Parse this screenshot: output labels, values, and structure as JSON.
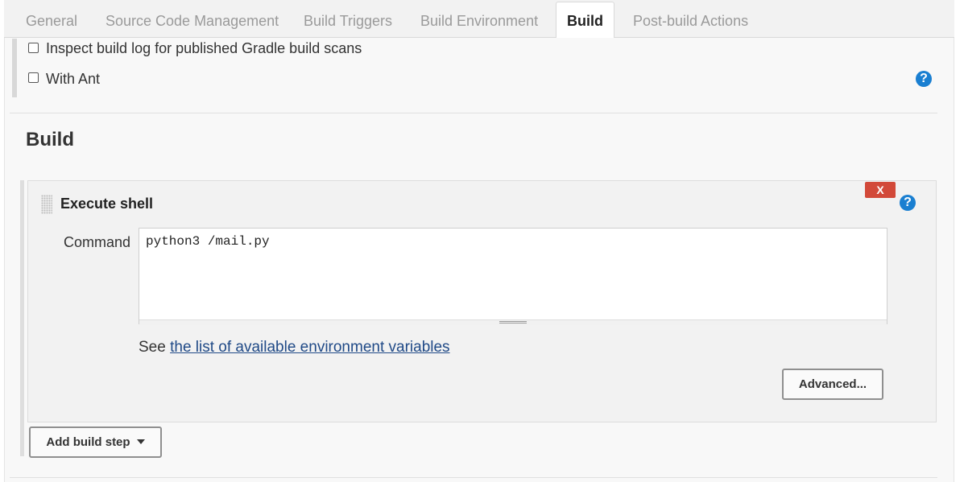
{
  "tabs": [
    {
      "label": "General"
    },
    {
      "label": "Source Code Management"
    },
    {
      "label": "Build Triggers"
    },
    {
      "label": "Build Environment"
    },
    {
      "label": "Build",
      "active": true
    },
    {
      "label": "Post-build Actions"
    }
  ],
  "build_env": {
    "inspect_gradle_label": "Inspect build log for published Gradle build scans",
    "inspect_gradle_checked": false,
    "with_ant_label": "With Ant",
    "with_ant_checked": false,
    "help_glyph": "?"
  },
  "build_section": {
    "title": "Build",
    "step": {
      "title": "Execute shell",
      "delete_label": "X",
      "help_glyph": "?",
      "command_label": "Command",
      "command_value": "python3 /mail.py",
      "see_prefix": "See",
      "env_vars_link": "the list of available environment variables",
      "advanced_label": "Advanced..."
    },
    "add_step_label": "Add build step"
  },
  "colors": {
    "help": "#1a7fd1",
    "delete": "#d24939",
    "link": "#204a87"
  }
}
